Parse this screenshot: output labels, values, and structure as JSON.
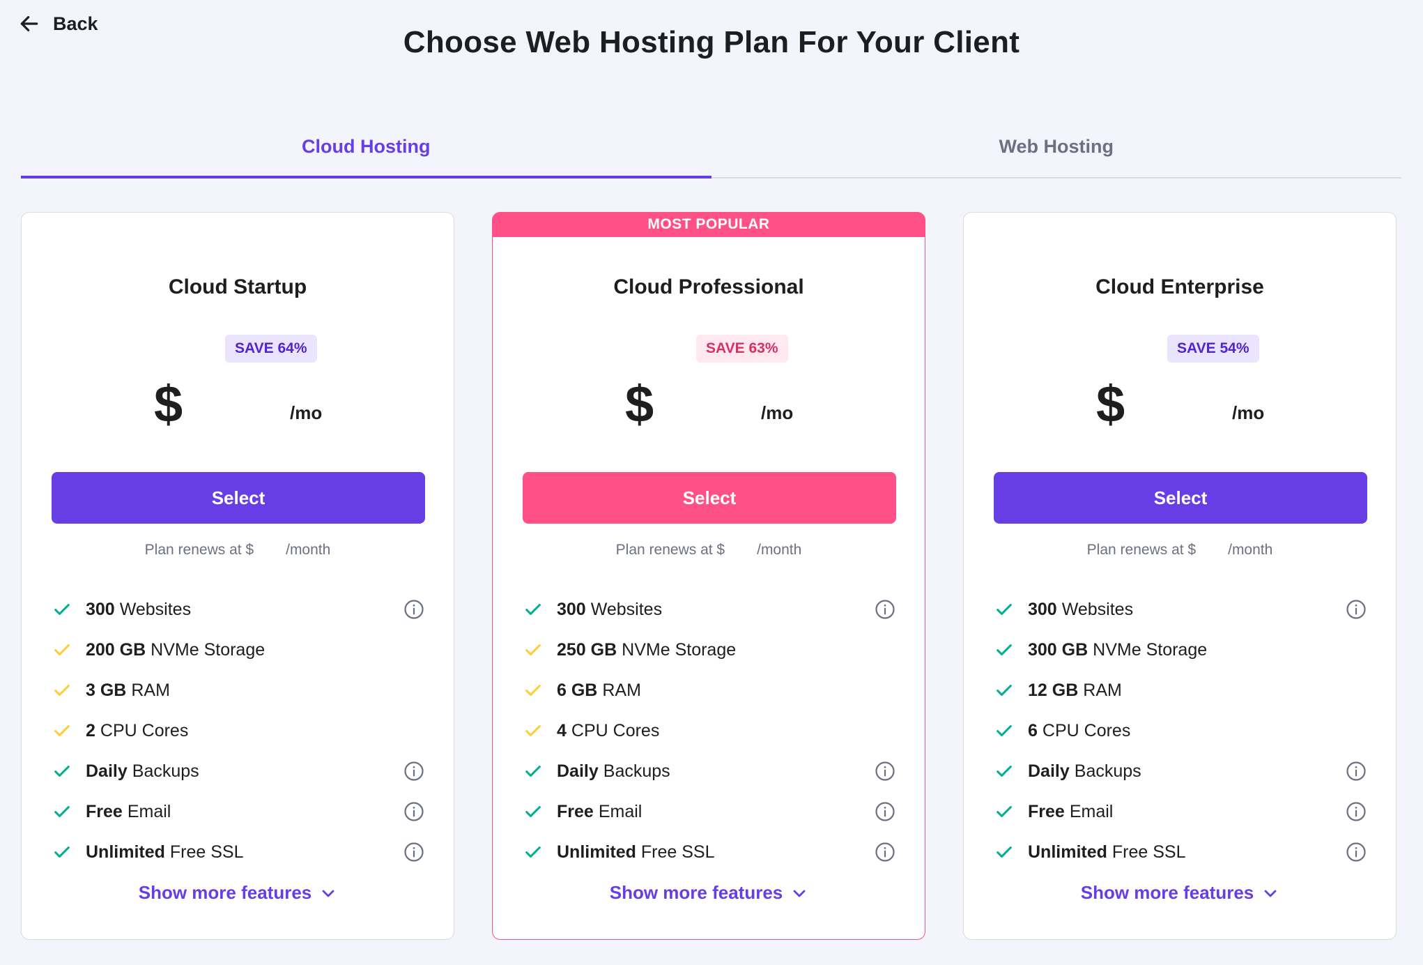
{
  "back_label": "Back",
  "page_title": "Choose Web Hosting Plan For Your Client",
  "tabs": [
    {
      "label": "Cloud Hosting",
      "active": true
    },
    {
      "label": "Web Hosting",
      "active": false
    }
  ],
  "colors": {
    "accent": "#673de6",
    "popular": "#ff5088",
    "check_green": "#00b090",
    "check_yellow": "#ffcd35",
    "background": "#f4f4fd"
  },
  "plans": [
    {
      "name": "Cloud Startup",
      "ribbon": "",
      "save": "SAVE 64%",
      "badge_theme": "purple",
      "currency": "$",
      "per": "/mo",
      "button": "Select",
      "button_theme": "purple",
      "renew_prefix": "Plan renews at $",
      "renew_suffix": "/month",
      "features": [
        {
          "bold": "300",
          "text": "Websites",
          "check": "green",
          "info": true
        },
        {
          "bold": "200 GB",
          "text": "NVMe Storage",
          "check": "yellow",
          "info": false
        },
        {
          "bold": "3 GB",
          "text": "RAM",
          "check": "yellow",
          "info": false
        },
        {
          "bold": "2",
          "text": "CPU Cores",
          "check": "yellow",
          "info": false
        },
        {
          "bold": "Daily",
          "text": "Backups",
          "check": "green",
          "info": true
        },
        {
          "bold": "Free",
          "text": "Email",
          "check": "green",
          "info": true
        },
        {
          "bold": "Unlimited",
          "text": "Free SSL",
          "check": "green",
          "info": true
        }
      ],
      "show_more": "Show more features"
    },
    {
      "name": "Cloud Professional",
      "ribbon": "MOST POPULAR",
      "save": "SAVE 63%",
      "badge_theme": "pink",
      "currency": "$",
      "per": "/mo",
      "button": "Select",
      "button_theme": "pink",
      "renew_prefix": "Plan renews at $",
      "renew_suffix": "/month",
      "features": [
        {
          "bold": "300",
          "text": "Websites",
          "check": "green",
          "info": true
        },
        {
          "bold": "250 GB",
          "text": "NVMe Storage",
          "check": "yellow",
          "info": false
        },
        {
          "bold": "6 GB",
          "text": "RAM",
          "check": "yellow",
          "info": false
        },
        {
          "bold": "4",
          "text": "CPU Cores",
          "check": "yellow",
          "info": false
        },
        {
          "bold": "Daily",
          "text": "Backups",
          "check": "green",
          "info": true
        },
        {
          "bold": "Free",
          "text": "Email",
          "check": "green",
          "info": true
        },
        {
          "bold": "Unlimited",
          "text": "Free SSL",
          "check": "green",
          "info": true
        }
      ],
      "show_more": "Show more features"
    },
    {
      "name": "Cloud Enterprise",
      "ribbon": "",
      "save": "SAVE 54%",
      "badge_theme": "purple",
      "currency": "$",
      "per": "/mo",
      "button": "Select",
      "button_theme": "purple",
      "renew_prefix": "Plan renews at $",
      "renew_suffix": "/month",
      "features": [
        {
          "bold": "300",
          "text": "Websites",
          "check": "green",
          "info": true
        },
        {
          "bold": "300 GB",
          "text": "NVMe Storage",
          "check": "green",
          "info": false
        },
        {
          "bold": "12 GB",
          "text": "RAM",
          "check": "green",
          "info": false
        },
        {
          "bold": "6",
          "text": "CPU Cores",
          "check": "green",
          "info": false
        },
        {
          "bold": "Daily",
          "text": "Backups",
          "check": "green",
          "info": true
        },
        {
          "bold": "Free",
          "text": "Email",
          "check": "green",
          "info": true
        },
        {
          "bold": "Unlimited",
          "text": "Free SSL",
          "check": "green",
          "info": true
        }
      ],
      "show_more": "Show more features"
    }
  ]
}
